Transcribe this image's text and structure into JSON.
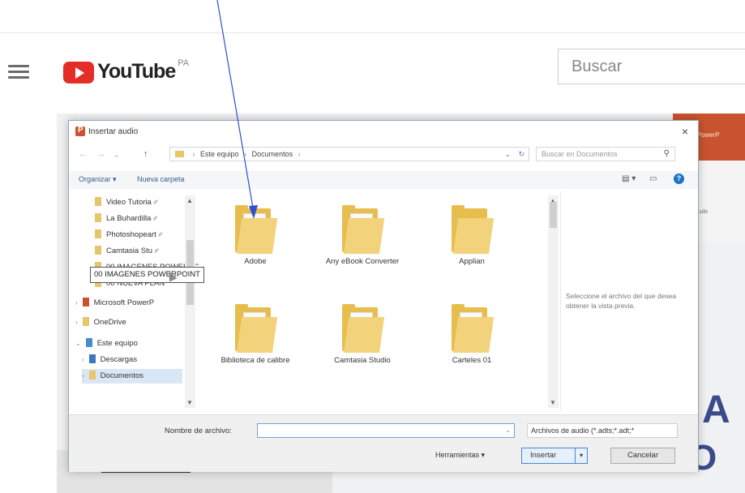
{
  "youtube": {
    "logo_text": "YouTube",
    "country_code": "PA",
    "search_placeholder": "Buscar"
  },
  "powerpoint_behind": {
    "title_fragment": "? - PowerP",
    "ribbon_fragment": "Vinculo"
  },
  "background_text": {
    "big_a": "A",
    "big_o": "O"
  },
  "dialog": {
    "title": "Insertar audio",
    "close": "×",
    "nav": {
      "back": "←",
      "forward": "→",
      "recent": "⌄",
      "up": "↑"
    },
    "breadcrumb": [
      "Este equipo",
      "Documentos"
    ],
    "search_placeholder": "Buscar en Documentos",
    "toolbar": {
      "organize": "Organizar ▾",
      "new_folder": "Nueva carpeta",
      "help": "?"
    },
    "nav_items": [
      {
        "label": "Video Tutoria",
        "pinned": true
      },
      {
        "label": "La Buhardilla",
        "pinned": true
      },
      {
        "label": "Photoshopeart",
        "pinned": true
      },
      {
        "label": "Camtasia Stu",
        "pinned": true
      },
      {
        "label": "00 IMAGENES POWERPOINT",
        "pinned": false
      },
      {
        "label": "00 NUEVA PLAN",
        "pinned": false
      },
      {
        "label": "Microsoft PowerP",
        "pinned": false
      },
      {
        "label": "OneDrive",
        "pinned": false
      },
      {
        "label": "Este equipo",
        "pinned": false
      },
      {
        "label": "Descargas",
        "pinned": false
      },
      {
        "label": "Documentos",
        "pinned": false
      }
    ],
    "tooltip": "00 IMAGENES POWERPOINT",
    "files": [
      {
        "label": "Adobe"
      },
      {
        "label": "Any eBook Converter"
      },
      {
        "label": "Applian"
      },
      {
        "label": "Biblioteca de calibre"
      },
      {
        "label": "Camtasia Studio"
      },
      {
        "label": "Carteles 01"
      }
    ],
    "preview_message": "Seleccione el archivo del que desea obtener la vista previa.",
    "filename_label": "Nombre de archivo:",
    "filename_value": "",
    "filter": "Archivos de audio (*.adts;*.adt;*",
    "tools": "Herramientas ▾",
    "insert": "Insertar",
    "cancel": "Cancelar"
  }
}
